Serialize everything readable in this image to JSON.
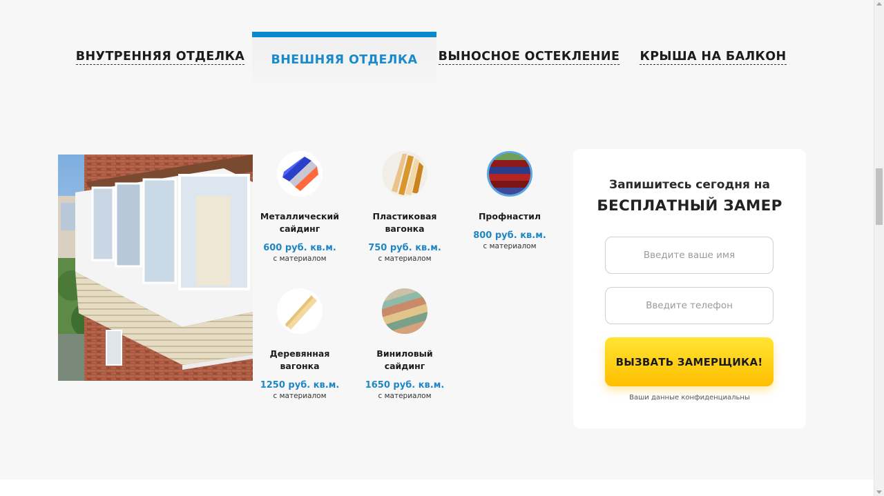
{
  "tabs": [
    {
      "label": "ВНУТРЕННЯЯ ОТДЕЛКА"
    },
    {
      "label": "ВНЕШНЯЯ ОТДЕЛКА"
    },
    {
      "label": "ВЫНОСНОЕ ОСТЕКЛЕНИЕ"
    },
    {
      "label": "КРЫША НА БАЛКОН"
    }
  ],
  "active_tab": "ВНЕШНЯЯ ОТДЕЛКА",
  "materials": [
    {
      "name": "Металлический сайдинг",
      "price": "600 руб. кв.м.",
      "note": "с материалом"
    },
    {
      "name": "Пластиковая вагонка",
      "price": "750 руб. кв.м.",
      "note": "с материалом"
    },
    {
      "name": "Профнастил",
      "price": "800 руб. кв.м.",
      "note": "с материалом"
    },
    {
      "name": "Деревянная вагонка",
      "price": "1250 руб. кв.м.",
      "note": "с материалом"
    },
    {
      "name": "Виниловый сайдинг",
      "price": "1650 руб. кв.м.",
      "note": "с материалом"
    }
  ],
  "form": {
    "subtitle": "Запишитесь сегодня на",
    "title": "БЕСПЛАТНЫЙ ЗАМЕР",
    "name_placeholder": "Введите ваше имя",
    "phone_placeholder": "Введите телефон",
    "button_label": "ВЫЗВАТЬ ЗАМЕРЩИКА!",
    "privacy_note": "Ваши данные конфиденциальны"
  },
  "colors": {
    "accent_blue": "#0a89cd",
    "price_blue": "#1f86c6",
    "button_yellow": "#ffc800",
    "background": "#f7f7f7"
  }
}
